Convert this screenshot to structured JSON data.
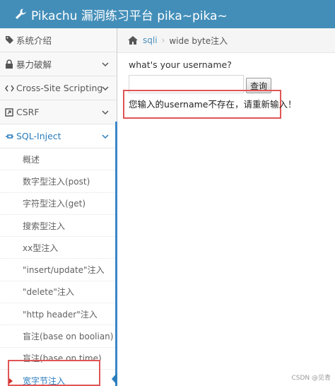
{
  "header": {
    "title": "Pikachu 漏洞练习平台 pika~pika~",
    "icon": "wrench-icon"
  },
  "sidebar": {
    "items": [
      {
        "label": "系统介绍",
        "icon": "tag-icon"
      },
      {
        "label": "暴力破解",
        "icon": "lock-icon"
      },
      {
        "label": "Cross-Site Scripting",
        "icon": "code-icon"
      },
      {
        "label": "CSRF",
        "icon": "share-icon"
      },
      {
        "label": "SQL-Inject",
        "icon": "syringe-icon"
      }
    ],
    "sql_sub_items": [
      "概述",
      "数字型注入(post)",
      "字符型注入(get)",
      "搜索型注入",
      "xx型注入",
      "\"insert/update\"注入",
      "\"delete\"注入",
      "\"http header\"注入",
      "盲注(base on boolian)",
      "盲注(base on time)",
      "宽字节注入"
    ]
  },
  "breadcrumb": {
    "section": "sqli",
    "current": "wide byte注入"
  },
  "form": {
    "prompt": "what's your username?",
    "username_value": "",
    "submit_label": "查询"
  },
  "notice": "您输入的username不存在，请重新输入！",
  "watermark": "CSDN @见青",
  "colors": {
    "navbar": "#438eb9",
    "active_blue": "#2b7dbc",
    "highlight_red": "#e05555"
  }
}
